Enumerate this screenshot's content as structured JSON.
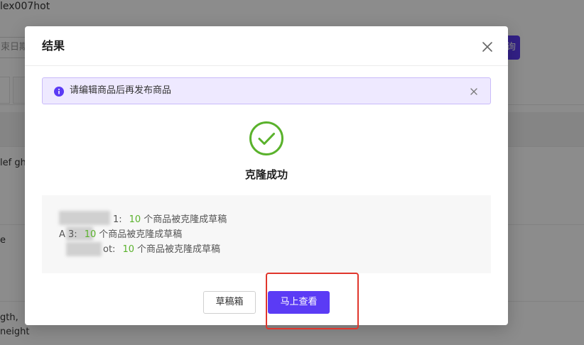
{
  "background": {
    "title_fragment": "lex007hot",
    "date_placeholder_fragment": "束日期",
    "query_button_fragment": "询",
    "row_texts": [
      "lef gh",
      "e",
      "gth,",
      "neight"
    ]
  },
  "modal": {
    "title": "结果",
    "alert_text": "请编辑商品后再发布商品",
    "success_title": "克隆成功",
    "results": [
      {
        "label": "1:",
        "count": "10",
        "suffix": "个商品被克隆成草稿"
      },
      {
        "label": "A    3:",
        "count": "10",
        "suffix": "个商品被克隆成草稿"
      },
      {
        "label": "ot:",
        "count": "10",
        "suffix": "个商品被克隆成草稿"
      }
    ],
    "draft_button": "草稿箱",
    "view_button": "马上查看"
  },
  "colors": {
    "primary": "#5b3bf5",
    "success": "#5ab22c",
    "alert_bg": "#eee9ff",
    "highlight": "#e0362c"
  },
  "icons": {
    "close": "close-icon",
    "info": "info-icon",
    "success": "check-circle-icon"
  }
}
